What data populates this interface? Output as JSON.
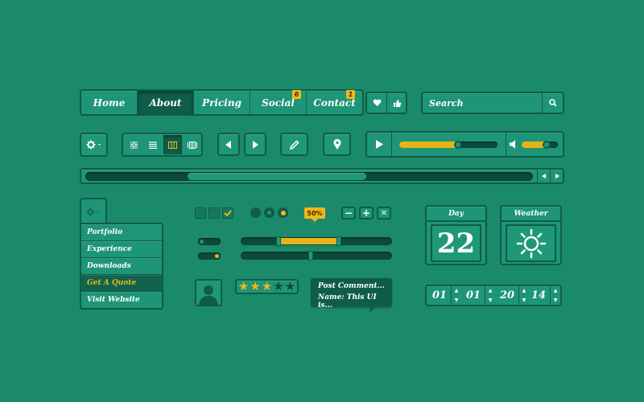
{
  "nav": {
    "items": [
      {
        "label": "Home"
      },
      {
        "label": "About",
        "active": true
      },
      {
        "label": "Pricing"
      },
      {
        "label": "Social",
        "badge": "6"
      },
      {
        "label": "Contact",
        "badge": "1"
      }
    ]
  },
  "search": {
    "placeholder": "Search"
  },
  "progress": {
    "badge": "50%"
  },
  "dropdown": {
    "items": [
      "Portfolio",
      "Experience",
      "Downloads",
      "Get A Quote",
      "Visit Website"
    ],
    "highlighted": "Get A Quote"
  },
  "rating": {
    "value": 3,
    "max": 5
  },
  "comment": {
    "line1": "Post Comment...",
    "line2": "Name: This UI is..."
  },
  "widgets": {
    "day_title": "Day",
    "day_value": "22",
    "weather_title": "Weather"
  },
  "timer": {
    "digits": [
      "01",
      "01",
      "20",
      "14"
    ]
  },
  "media": {
    "progress_fraction": 0.6,
    "volume_fraction": 0.7
  },
  "scrollbar": {
    "position_fraction": 0.38
  },
  "colors": {
    "background": "#1a8a6b",
    "accent": "#f2b619",
    "dark": "#0f5c48"
  }
}
